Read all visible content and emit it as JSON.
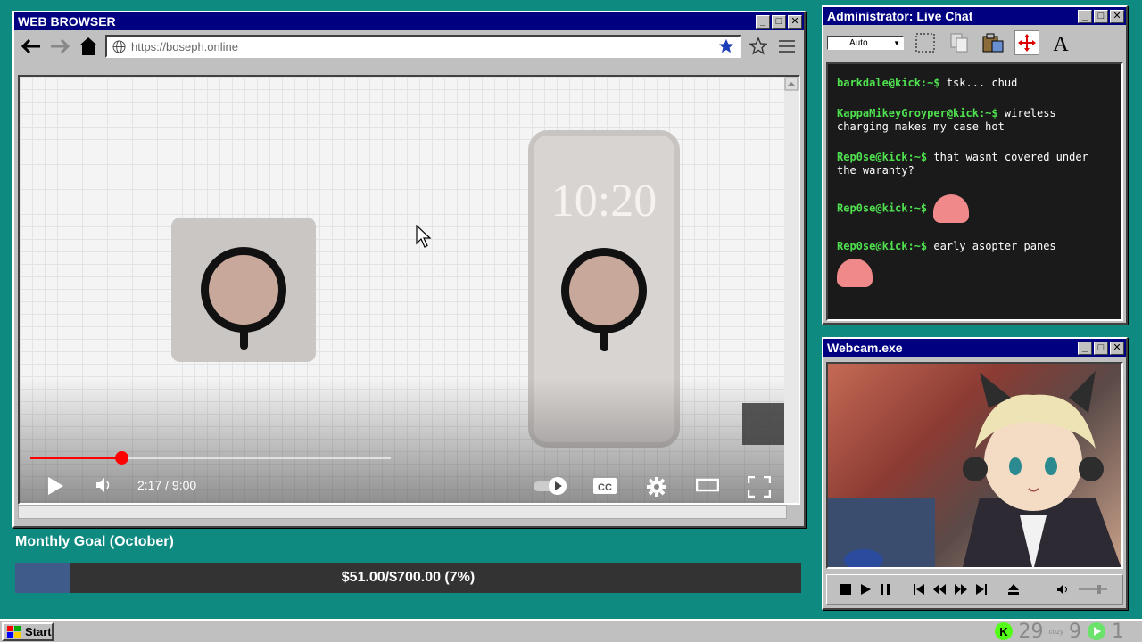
{
  "colors": {
    "desktop": "#0f8a80",
    "titlebar": "#000080",
    "chat_user": "#4fe04f",
    "progress": "#ff0000",
    "goal_fill": "#3f5b8a"
  },
  "browser": {
    "title": "WEB BROWSER",
    "url": "https://boseph.online",
    "video": {
      "phone_clock": "10:20",
      "time_display": "2:17 / 9:00",
      "progress_fraction": 0.2537
    }
  },
  "goal": {
    "title": "Monthly Goal (October)",
    "amount_text": "$51.00/$700.00 (7%)",
    "fraction": 0.07
  },
  "chat": {
    "title": "Administrator: Live Chat",
    "auto_select": "Auto",
    "messages": [
      {
        "user": "barkdale@kick:~$",
        "text": "tsk... chud"
      },
      {
        "user": "KappaMikeyGroyper@kick:~$",
        "text": "wireless charging makes my case hot"
      },
      {
        "user": "Rep0se@kick:~$",
        "text": "that wasnt covered under the waranty?"
      },
      {
        "user": "Rep0se@kick:~$",
        "text": ""
      },
      {
        "user": "Rep0se@kick:~$",
        "text": "early asopter panes"
      }
    ]
  },
  "webcam": {
    "title": "Webcam.exe"
  },
  "taskbar": {
    "start_label": "Start",
    "tray_viewers": "29",
    "tray_followers": "9",
    "tray_subs": "1",
    "tray_small": "cozy"
  }
}
